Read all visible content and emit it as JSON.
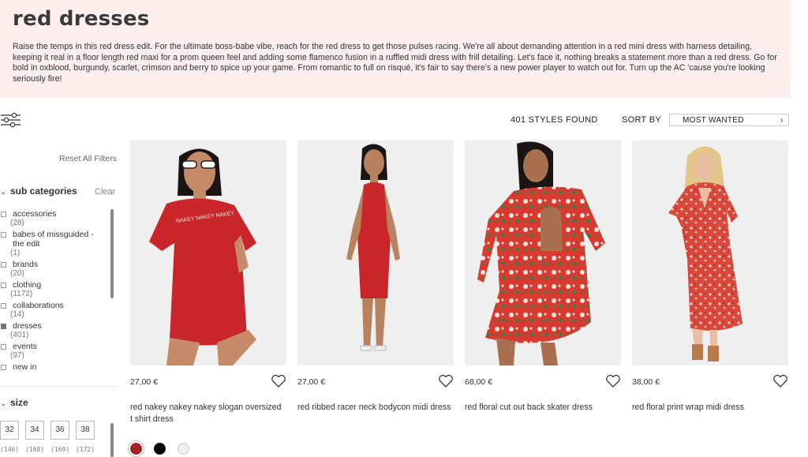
{
  "banner": {
    "title": "red dresses",
    "description": "Raise the temps in this red dress edit. For the ultimate boss-babe vibe, reach for the red dress to get those pulses racing. We're all about demanding attention in a red mini dress with harness detailing, keeping it real in a floor length red maxi for a prom queen feel and adding some flamenco fusion in a ruffled midi dress with frill detailing. Let's face it, nothing breaks a statement more than a red dress. Go for bold in oxblood, burgundy, scarlet, crimson and berry to spice up your game. From romantic to full on risqué, it's fair to say there's a new power player to watch out for. Turn up the AC 'cause you're looking seriously fire!"
  },
  "toolbar": {
    "filter_icon": "sliders-icon",
    "count": "401 STYLES FOUND",
    "sort_label": "SORT BY",
    "sort_value": "MOST WANTED"
  },
  "sidebar": {
    "reset": "Reset All Filters",
    "sub_categories": {
      "title": "sub categories",
      "clear": "Clear",
      "items": [
        {
          "label": "accessories",
          "count": "(28)",
          "checked": false
        },
        {
          "label": "babes of missguided - the edit",
          "count": "(1)",
          "checked": false
        },
        {
          "label": "brands",
          "count": "(20)",
          "checked": false
        },
        {
          "label": "clothing",
          "count": "(1172)",
          "checked": false
        },
        {
          "label": "collaborations",
          "count": "(14)",
          "checked": false
        },
        {
          "label": "dresses",
          "count": "(401)",
          "checked": true
        },
        {
          "label": "events",
          "count": "(97)",
          "checked": false
        },
        {
          "label": "new in",
          "count": "",
          "checked": false
        }
      ]
    },
    "size": {
      "title": "size",
      "items": [
        {
          "label": "32",
          "count": "(146)"
        },
        {
          "label": "34",
          "count": "(168)"
        },
        {
          "label": "36",
          "count": "(169)"
        },
        {
          "label": "38",
          "count": "(172)"
        }
      ]
    }
  },
  "products": [
    {
      "price": "27,00 €",
      "name": "red nakey nakey nakey slogan oversized t shirt dress",
      "slogan": "NAKEY NAKEY NAKEY"
    },
    {
      "price": "27,00 €",
      "name": "red ribbed racer neck bodycon midi dress"
    },
    {
      "price": "68,00 €",
      "name": "red floral cut out back skater dress"
    },
    {
      "price": "38,00 €",
      "name": "red floral print wrap midi dress"
    }
  ],
  "swatches": [
    {
      "name": "red",
      "color": "#a3232a"
    },
    {
      "name": "black",
      "color": "#000000"
    },
    {
      "name": "white",
      "color": "#efefef"
    }
  ],
  "colors": {
    "banner_bg": "#fcefee",
    "dress_red": "#c8262a",
    "floral_red": "#d93a2f"
  }
}
